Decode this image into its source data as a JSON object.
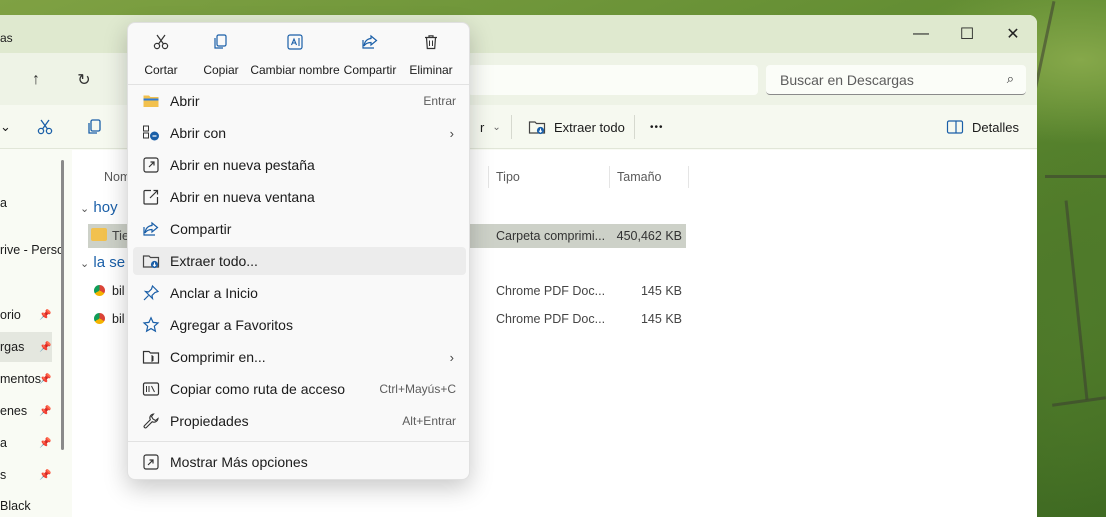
{
  "window": {
    "title_fragment": "as",
    "minimize": "—",
    "maximize": "☐",
    "close": "✕"
  },
  "address": {
    "up_icon": "↑",
    "refresh_icon": "↻",
    "search_placeholder": "Buscar en Descargas"
  },
  "toolbar": {
    "extract_all": "Extraer todo",
    "more": "•••",
    "details": "Detalles",
    "partial_label": "r"
  },
  "sidebar": {
    "items": [
      {
        "label": "a"
      },
      {
        "label": "rive - Perso"
      },
      {
        "label": "orio"
      },
      {
        "label": "rgas"
      },
      {
        "label": "mentos"
      },
      {
        "label": "enes"
      },
      {
        "label": "a"
      },
      {
        "label": "s"
      },
      {
        "label": "Black"
      }
    ]
  },
  "content": {
    "columns": {
      "name": "Nom",
      "type": "Tipo",
      "size": "Tamaño"
    },
    "groups": [
      {
        "label": "hoy"
      },
      {
        "label": "la se"
      }
    ],
    "rows": [
      {
        "name": "Tie",
        "type": "Carpeta comprimi...",
        "size": "450,462 KB"
      },
      {
        "name": "bil",
        "type": "Chrome PDF Doc...",
        "size": "145 KB"
      },
      {
        "name": "bil",
        "type": "Chrome PDF Doc...",
        "size": "145 KB"
      }
    ]
  },
  "context_menu": {
    "quick_actions": [
      {
        "label": "Cortar",
        "icon": "scissors-icon"
      },
      {
        "label": "Copiar",
        "icon": "copy-icon"
      },
      {
        "label": "Cambiar nombre",
        "icon": "rename-icon"
      },
      {
        "label": "Compartir",
        "icon": "share-icon"
      },
      {
        "label": "Eliminar",
        "icon": "trash-icon"
      }
    ],
    "items": [
      {
        "label": "Abrir",
        "shortcut": "Entrar",
        "icon": "folder-icon"
      },
      {
        "label": "Abrir con",
        "submenu": true,
        "icon": "open-with-icon"
      },
      {
        "label": "Abrir en nueva pestaña",
        "icon": "new-tab-icon"
      },
      {
        "label": "Abrir en nueva ventana",
        "icon": "new-window-icon"
      },
      {
        "label": "Compartir",
        "icon": "share-icon"
      },
      {
        "label": "Extraer todo...",
        "icon": "extract-icon"
      },
      {
        "label": "Anclar a Inicio",
        "icon": "pin-icon"
      },
      {
        "label": "Agregar a Favoritos",
        "icon": "star-icon"
      },
      {
        "label": "Comprimir en...",
        "submenu": true,
        "icon": "compress-icon"
      },
      {
        "label": "Copiar como ruta de acceso",
        "shortcut": "Ctrl+Mayús+C",
        "icon": "path-icon"
      },
      {
        "label": "Propiedades",
        "shortcut": "Alt+Entrar",
        "icon": "wrench-icon"
      }
    ],
    "more_options": {
      "label": "Mostrar Más opciones",
      "icon": "more-options-icon"
    }
  },
  "colors": {
    "accent": "#1a5fa8",
    "folder_yellow": "#f2c14e"
  }
}
